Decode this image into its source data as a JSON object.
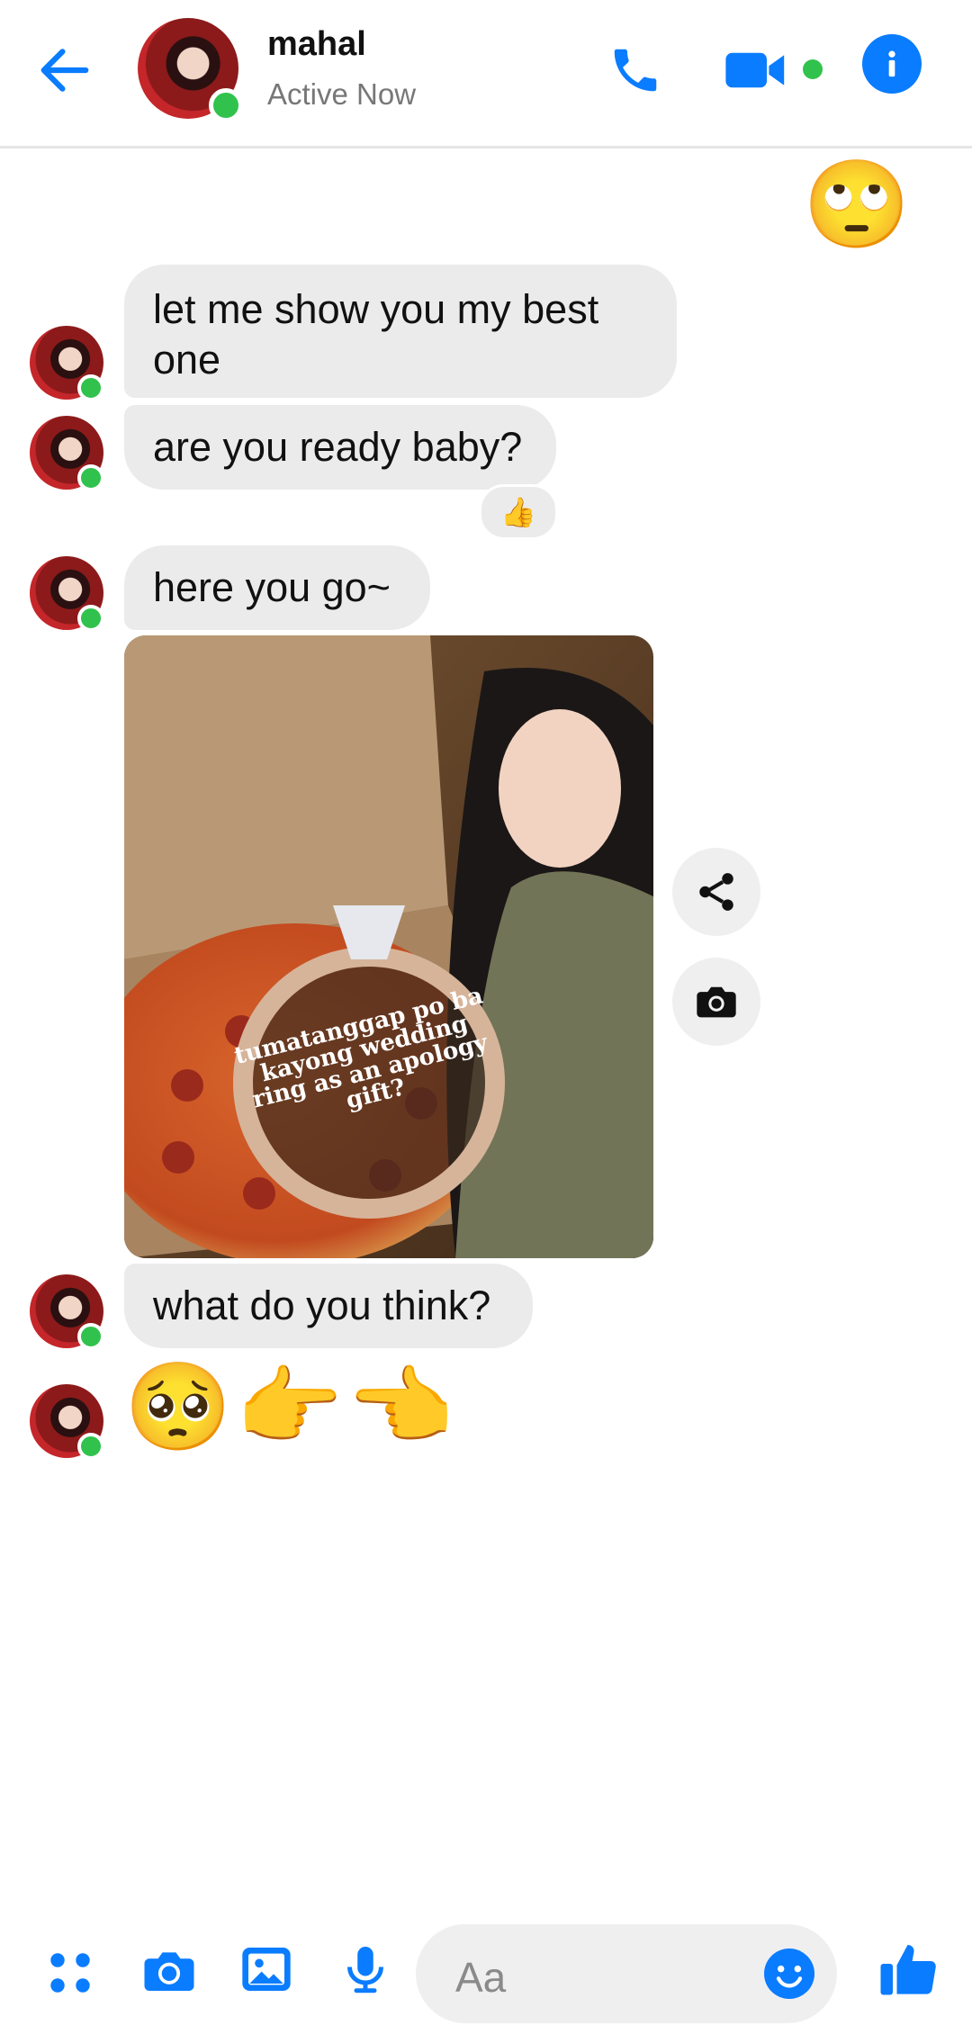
{
  "header": {
    "title": "mahal",
    "status": "Active Now",
    "icons": {
      "back": "arrow-left-icon",
      "call": "phone-icon",
      "video": "video-camera-icon",
      "info": "info-icon"
    },
    "accent": "#0a7cff",
    "online_color": "#31c24d"
  },
  "messages": [
    {
      "from": "me",
      "type": "emoji",
      "text": "🙄"
    },
    {
      "from": "them",
      "type": "text",
      "text": "let me show you my best one"
    },
    {
      "from": "them",
      "type": "text",
      "text": "are you ready baby?",
      "reaction": "👍"
    },
    {
      "from": "them",
      "type": "text",
      "text": "here you go~"
    },
    {
      "from": "them",
      "type": "image",
      "image_text": "tumatanggap po ba kayong wedding ring as an apology gift?"
    },
    {
      "from": "them",
      "type": "text",
      "text": "what do you think?"
    },
    {
      "from": "them",
      "type": "emoji",
      "text": "🥺👉👈"
    }
  ],
  "image_actions": {
    "share": "share-icon",
    "camera": "camera-icon"
  },
  "composer": {
    "placeholder": "Aa",
    "icons": [
      "grid-dots-icon",
      "camera-icon",
      "gallery-icon",
      "microphone-icon",
      "emoji-smile-icon",
      "thumbs-up-icon"
    ]
  }
}
